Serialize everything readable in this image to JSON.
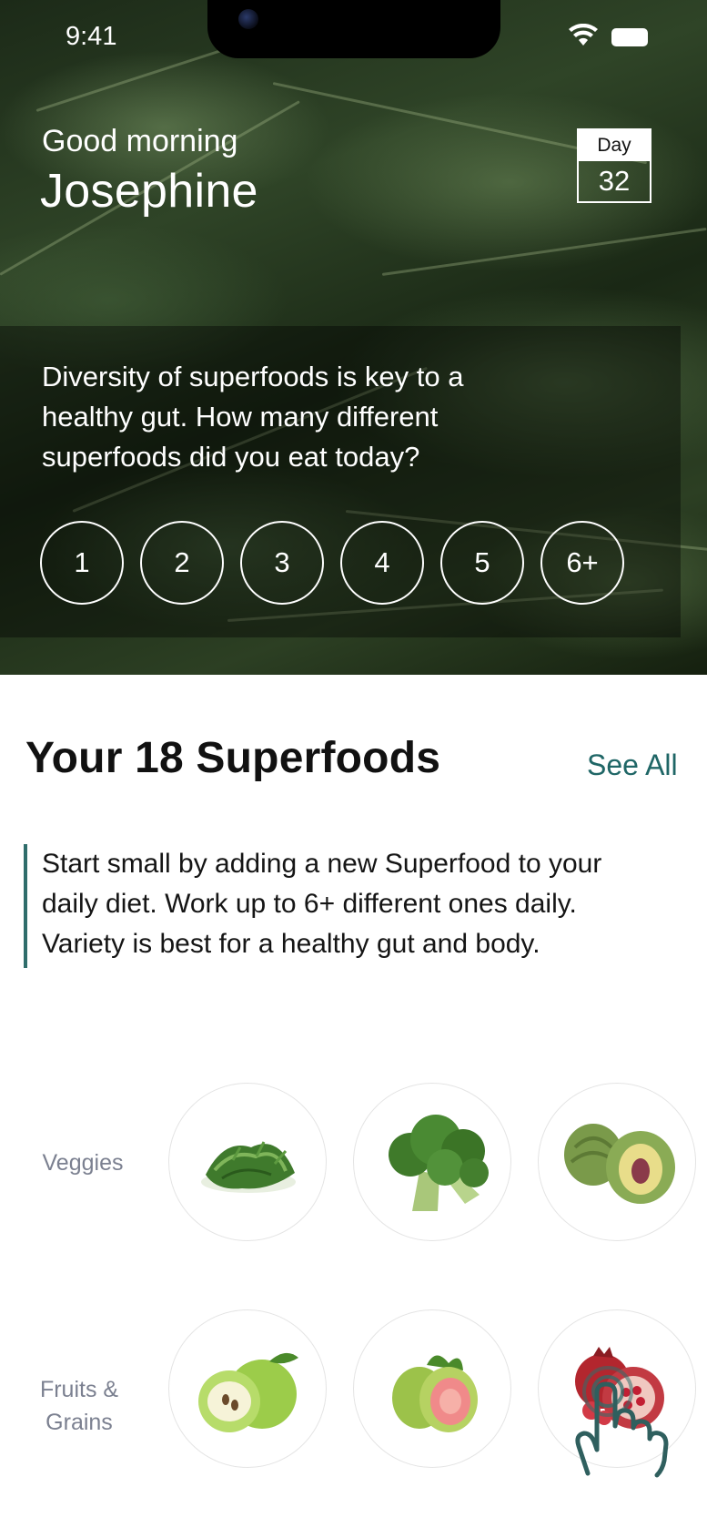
{
  "status_bar": {
    "time": "9:41",
    "icons": [
      "wifi-icon",
      "battery-icon"
    ]
  },
  "header": {
    "greeting": "Good morning",
    "name": "Josephine",
    "day_label": "Day",
    "day_number": "32"
  },
  "prompt": {
    "question": "Diversity of superfoods is key to a healthy gut. How many different superfoods did you eat today?",
    "options": [
      "1",
      "2",
      "3",
      "4",
      "5",
      "6+"
    ]
  },
  "superfoods": {
    "title": "Your 18 Superfoods",
    "see_all": "See All",
    "tip": "Start small by adding a new Superfood to your daily diet. Work up to 6+ different ones daily. Variety is best for a healthy gut and body.",
    "rows": [
      {
        "label": "Veggies",
        "items": [
          "arugula-icon",
          "broccoli-icon",
          "artichoke-icon"
        ]
      },
      {
        "label": "Fruits & Grains",
        "items": [
          "green-apple-icon",
          "guava-icon",
          "pomegranate-icon"
        ]
      }
    ]
  },
  "colors": {
    "accent": "#1f6666",
    "tip_border": "#2f6d6b",
    "label_gray": "#7b8090"
  }
}
